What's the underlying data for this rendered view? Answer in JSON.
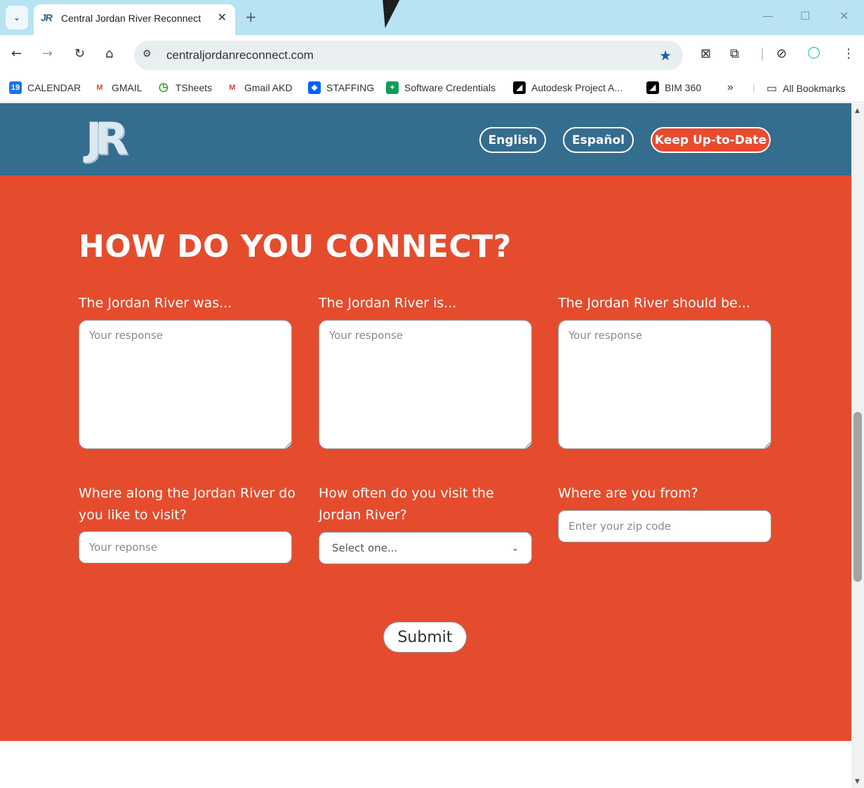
{
  "browser": {
    "tab_title": "Central Jordan River Reconnect",
    "tab_favicon_text": "JR",
    "url": "centraljordanreconnect.com",
    "bookmarks": [
      {
        "label": "CALENDAR",
        "icon": "calendar-icon",
        "icon_text": "19",
        "color": "#1a73e8"
      },
      {
        "label": "GMAIL",
        "icon": "gmail-icon",
        "icon_text": "M",
        "color": "#ea4335"
      },
      {
        "label": "TSheets",
        "icon": "tsheets-clock-icon",
        "icon_text": "◷",
        "color": "#2ca01c"
      },
      {
        "label": "Gmail AKD",
        "icon": "gmail-icon",
        "icon_text": "M",
        "color": "#ea4335"
      },
      {
        "label": "STAFFING",
        "icon": "dropbox-icon",
        "icon_text": "◆",
        "color": "#0061fe"
      },
      {
        "label": "Software Credentials",
        "icon": "sheets-icon",
        "icon_text": "+",
        "color": "#0f9d58"
      },
      {
        "label": "Autodesk Project A...",
        "icon": "autodesk-icon",
        "icon_text": "◢",
        "color": "#000000"
      },
      {
        "label": "BIM 360",
        "icon": "autodesk-icon",
        "icon_text": "◢",
        "color": "#000000"
      }
    ],
    "bookmarks_overflow": "»",
    "all_bookmarks": "All Bookmarks"
  },
  "header": {
    "logo_text": "JR",
    "english_label": "English",
    "espanol_label": "Español",
    "keep_label": "Keep Up-to-Date"
  },
  "form": {
    "title": "HOW DO YOU CONNECT?",
    "was_label": "The Jordan River was...",
    "is_label": "The Jordan River is...",
    "should_label": "The Jordan River should be...",
    "response_placeholder": "Your response",
    "where_label": "Where along the Jordan River do you like to visit?",
    "where_placeholder": "Your reponse",
    "often_label": "How often do you visit the Jordan River?",
    "often_selected": "Select one...",
    "from_label": "Where are you from?",
    "zip_placeholder": "Enter your zip code",
    "submit_label": "Submit"
  },
  "colors": {
    "header_blue": "#356d8f",
    "hero_orange": "#e54c2d",
    "tabstrip": "#b7e3f2"
  }
}
